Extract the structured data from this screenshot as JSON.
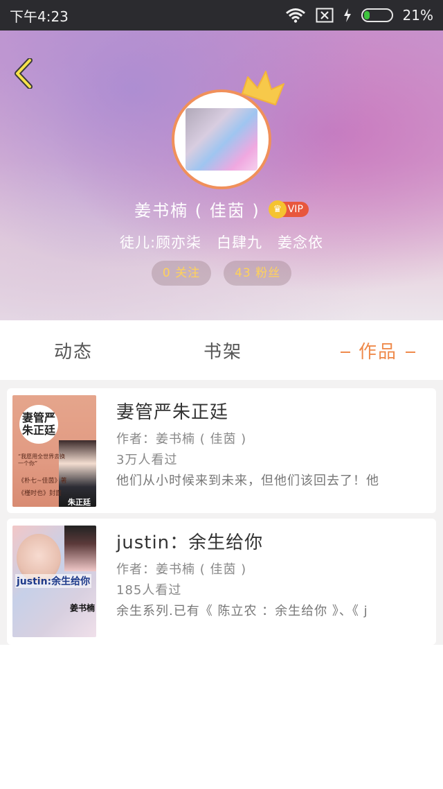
{
  "status_bar": {
    "time": "下午4:23",
    "battery_percent": "21%",
    "battery_level": 0.21,
    "icons": [
      "wifi-icon",
      "no-sim-icon",
      "charging-icon",
      "battery-icon"
    ],
    "battery_color": "#3ec43e"
  },
  "profile": {
    "name": "姜书楠 ( 佳茵 )",
    "vip_label": "VIP",
    "disciples_label": "徒儿:",
    "disciples": [
      "顾亦柒",
      "白肆九",
      "姜念依"
    ],
    "following": "0 关注",
    "followers": "43 粉丝",
    "avatar_border_color": "#f0905a",
    "crown_color": "#f7c94a"
  },
  "tabs": [
    {
      "label": "动态",
      "active": false
    },
    {
      "label": "书架",
      "active": false
    },
    {
      "label": "作品",
      "active": true
    }
  ],
  "accent_color": "#ef8a4b",
  "works": [
    {
      "title": "妻管严朱正廷",
      "author": "作者：姜书楠 ( 佳茵 )",
      "views": "3万人看过",
      "desc": "他们从小时候来到未来，但他们该回去了！他",
      "cover": {
        "title": "妻管严 朱正廷",
        "line1": "“我愿用全世界去换一个你”",
        "line2": "《朴七~佳茵》著",
        "line3": "《槿时也》封面",
        "signature": "朱正廷"
      }
    },
    {
      "title": "justin：余生给你",
      "author": "作者：姜书楠 ( 佳茵 )",
      "views": "185人看过",
      "desc": "余生系列.已有《 陈立农 ：余生给你 》、《 j",
      "cover": {
        "label": "justin:余生给你",
        "signature": "姜书楠"
      }
    }
  ]
}
